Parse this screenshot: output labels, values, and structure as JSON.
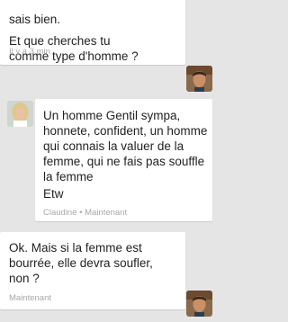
{
  "messages": [
    {
      "sender": "me",
      "lines": [
        "sais bien."
      ],
      "text2": "Et que cherches tu comme type d'homme ?",
      "meta": "Il y a 3 min"
    },
    {
      "sender": "Claudine",
      "text": "Un homme Gentil sympa, honnete, confident, un homme qui connais la valuer de la femme, qui ne fais pas souffle la femme",
      "text2": "Etw",
      "meta": "Claudine • Maintenant"
    },
    {
      "sender": "me",
      "text": "Ok. Mais si la femme est bourrée, elle devra soufler, non ?",
      "meta": "Maintenant"
    }
  ]
}
